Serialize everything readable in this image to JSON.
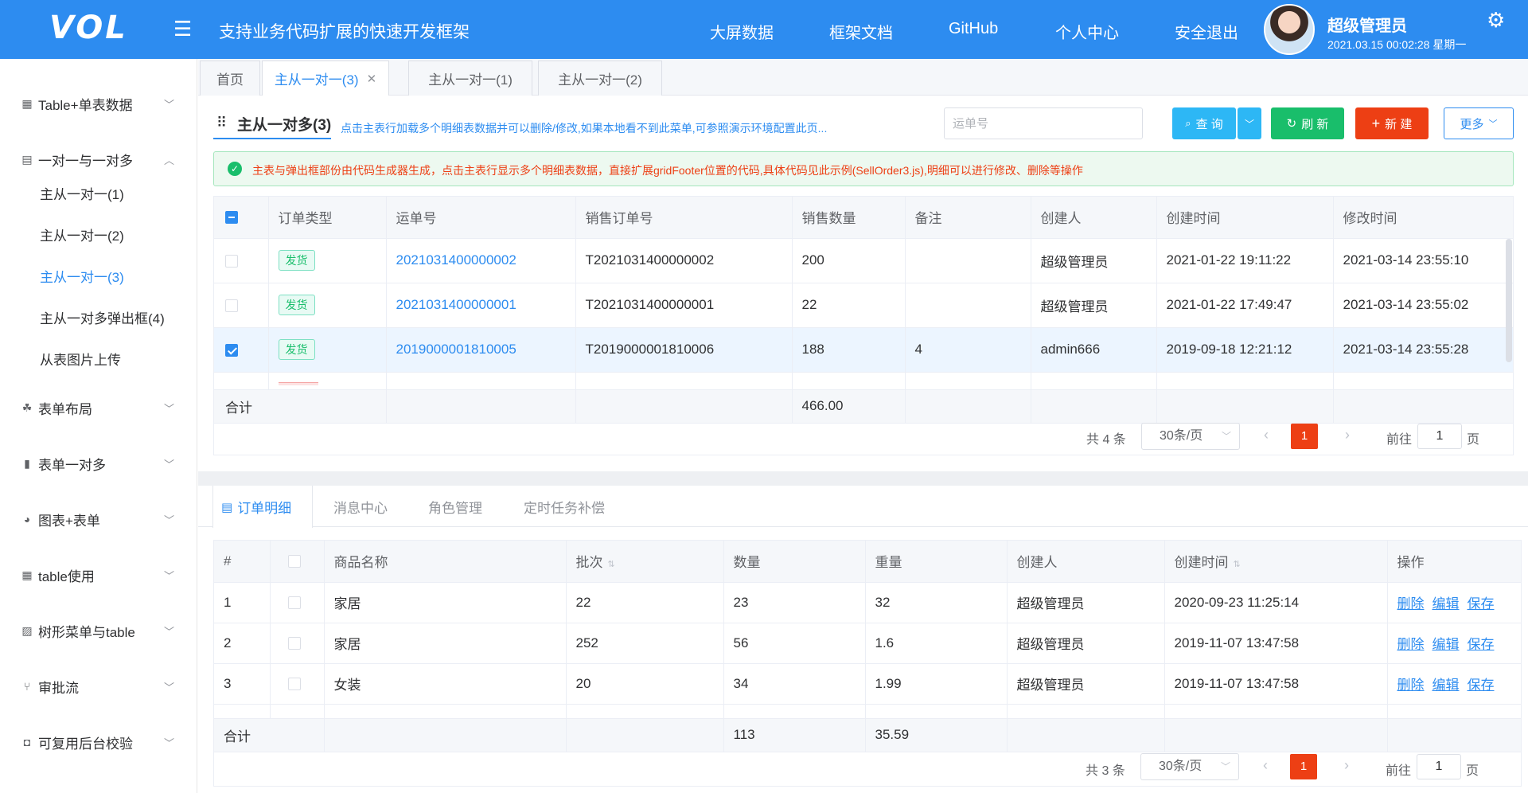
{
  "header": {
    "logo": "VOL",
    "title": "支持业务代码扩展的快速开发框架",
    "nav": [
      "大屏数据",
      "框架文档",
      "GitHub",
      "个人中心",
      "安全退出"
    ],
    "user_name": "超级管理员",
    "user_time": "2021.03.15 00:02:28 星期一"
  },
  "sidebar": {
    "groups": [
      {
        "label": "Table+单表数据",
        "icon": "table-icon"
      },
      {
        "label": "一对一与一对多",
        "icon": "list-icon"
      },
      {
        "label": "表单布局",
        "icon": "layout-icon"
      },
      {
        "label": "表单一对多",
        "icon": "bar-icon"
      },
      {
        "label": "图表+表单",
        "icon": "pie-icon"
      },
      {
        "label": "table使用",
        "icon": "table-icon"
      },
      {
        "label": "树形菜单与table",
        "icon": "chart-icon"
      },
      {
        "label": "审批流",
        "icon": "flow-icon"
      },
      {
        "label": "可复用后台校验",
        "icon": "toggle-icon"
      }
    ],
    "subitems": [
      "主从一对一(1)",
      "主从一对一(2)",
      "主从一对一(3)",
      "主从一对多弹出框(4)",
      "从表图片上传"
    ]
  },
  "tabs": [
    "首页",
    "主从一对一(3)",
    "主从一对一(1)",
    "主从一对一(2)"
  ],
  "toolbar": {
    "section_title": "主从一对多(3)",
    "hint": "点击主表行加载多个明细表数据并可以删除/修改,如果本地看不到此菜单,可参照演示环境配置此页...",
    "search_placeholder": "运单号",
    "query": "查 询",
    "refresh": "刷 新",
    "new": "新 建",
    "more": "更多"
  },
  "alert": "主表与弹出框部份由代码生成器生成，点击主表行显示多个明细表数据，直接扩展gridFooter位置的代码,具体代码见此示例(SellOrder3.js),明细可以进行修改、删除等操作",
  "main_table": {
    "headers": [
      "订单类型",
      "运单号",
      "销售订单号",
      "销售数量",
      "备注",
      "创建人",
      "创建时间",
      "修改时间"
    ],
    "rows": [
      {
        "type": "发货",
        "waybill": "2021031400000002",
        "order": "T2021031400000002",
        "qty": "200",
        "remark": "",
        "creator": "超级管理员",
        "created": "2021-01-22 19:11:22",
        "modified": "2021-03-14 23:55:10"
      },
      {
        "type": "发货",
        "waybill": "2021031400000001",
        "order": "T2021031400000001",
        "qty": "22",
        "remark": "",
        "creator": "超级管理员",
        "created": "2021-01-22 17:49:47",
        "modified": "2021-03-14 23:55:02"
      },
      {
        "type": "发货",
        "waybill": "2019000001810005",
        "order": "T2019000001810006",
        "qty": "188",
        "remark": "4",
        "creator": "admin666",
        "created": "2019-09-18 12:21:12",
        "modified": "2021-03-14 23:55:28"
      }
    ],
    "sum_label": "合计",
    "sum_qty": "466.00"
  },
  "pager1": {
    "total": "共 4 条",
    "size": "30条/页",
    "page": "1",
    "goto": "前往",
    "page_input": "1",
    "page_unit": "页"
  },
  "bottom_tabs": [
    "订单明细",
    "消息中心",
    "角色管理",
    "定时任务补偿"
  ],
  "detail_table": {
    "headers": [
      "#",
      "商品名称",
      "批次",
      "数量",
      "重量",
      "创建人",
      "创建时间",
      "操作"
    ],
    "rows": [
      {
        "no": "1",
        "name": "家居",
        "batch": "22",
        "qty": "23",
        "weight": "32",
        "creator": "超级管理员",
        "created": "2020-09-23 11:25:14"
      },
      {
        "no": "2",
        "name": "家居",
        "batch": "252",
        "qty": "56",
        "weight": "1.6",
        "creator": "超级管理员",
        "created": "2019-11-07 13:47:58"
      },
      {
        "no": "3",
        "name": "女装",
        "batch": "20",
        "qty": "34",
        "weight": "1.99",
        "creator": "超级管理员",
        "created": "2019-11-07 13:47:58"
      }
    ],
    "ops": [
      "删除",
      "编辑",
      "保存"
    ],
    "sum_label": "合计",
    "sum_qty": "113",
    "sum_weight": "35.59"
  },
  "pager2": {
    "total": "共 3 条",
    "size": "30条/页",
    "page": "1",
    "goto": "前往",
    "page_input": "1",
    "page_unit": "页"
  },
  "colors": {
    "primary": "#2d8cf0",
    "info": "#2db7f5",
    "success": "#19be6b",
    "error": "#ed3f14"
  }
}
